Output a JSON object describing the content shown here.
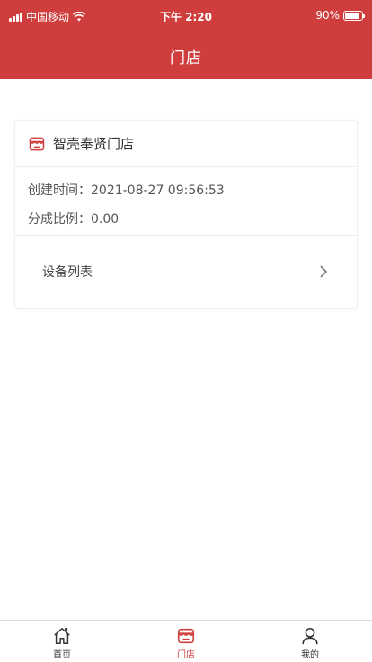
{
  "status_bar": {
    "carrier": "中国移动",
    "time": "下午 2:20",
    "battery": "90%",
    "battery_level": 0.9
  },
  "nav": {
    "title": "门店"
  },
  "store": {
    "name": "智壳奉贤门店",
    "created_label": "创建时间：",
    "created_value": "2021-08-27 09:56:53",
    "ratio_label": "分成比例：",
    "ratio_value": "0.00",
    "menu_label": "设备列表"
  },
  "tabs": [
    {
      "label": "首页",
      "icon": "home-icon",
      "active": false
    },
    {
      "label": "门店",
      "icon": "store-icon",
      "active": true
    },
    {
      "label": "我的",
      "icon": "user-icon",
      "active": false
    }
  ],
  "colors": {
    "primary": "#cf3d3d",
    "text": "#333333",
    "muted": "#555555"
  }
}
